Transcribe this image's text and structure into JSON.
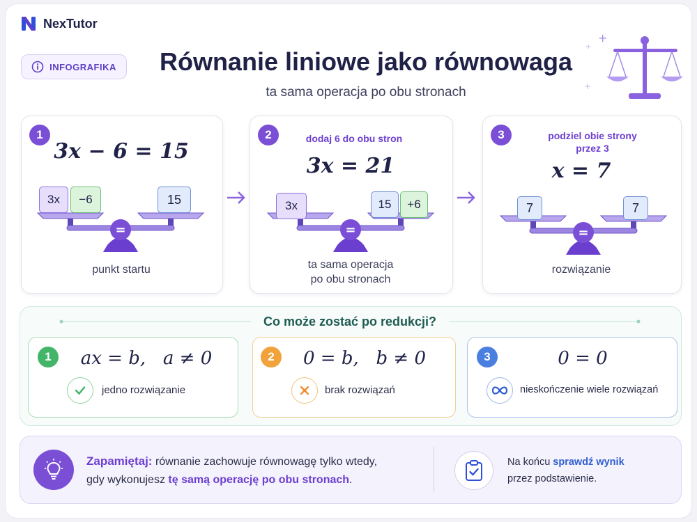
{
  "brand": {
    "name": "NexTutor"
  },
  "badge": {
    "label": "INFOGRAFIKA"
  },
  "header": {
    "title": "Równanie liniowe jako równowaga",
    "subtitle": "ta sama operacja po obu stronach"
  },
  "steps": [
    {
      "number": "1",
      "equation": "3x − 6 = 15",
      "left_tiles": [
        "3x",
        "−6"
      ],
      "right_tiles": [
        "15"
      ],
      "label_lines": [
        "punkt startu"
      ]
    },
    {
      "number": "2",
      "operation_lines": [
        "dodaj 6 do obu stron"
      ],
      "equation": "3x = 21",
      "left_tiles": [
        "3x"
      ],
      "right_tiles": [
        "15",
        "+6"
      ],
      "label_lines": [
        "ta sama operacja",
        "po obu stronach"
      ]
    },
    {
      "number": "3",
      "operation_lines": [
        "podziel obie strony",
        "przez 3"
      ],
      "equation": "x = 7",
      "left_tiles": [
        "7"
      ],
      "right_tiles": [
        "7"
      ],
      "label_lines": [
        "rozwiązanie"
      ]
    }
  ],
  "balance_symbol": "=",
  "reduction": {
    "title": "Co może zostać po redukcji?",
    "options": [
      {
        "number": "1",
        "equation": "ax = b,   a ≠ 0",
        "text": "jedno rozwiązanie",
        "accent": "#43b56a"
      },
      {
        "number": "2",
        "equation": "0 = b,   b ≠ 0",
        "text": "brak rozwiązań",
        "accent": "#f2a23a"
      },
      {
        "number": "3",
        "equation": "0 = 0",
        "text": "nieskończenie wiele rozwiązań",
        "accent": "#4a7fe0"
      }
    ]
  },
  "note": {
    "lead": "Zapamiętaj:",
    "line1": "równanie zachowuje równowagę tylko wtedy,",
    "line2_prefix": "gdy wykonujesz",
    "line2_highlight": "tę samą operację po obu stronach",
    "line2_suffix": ".",
    "check_prefix": "Na końcu",
    "check_highlight": "sprawdź wynik",
    "check_line2": "przez podstawienie."
  },
  "colors": {
    "primary": "#7a4fd6",
    "navy": "#1f2147",
    "green": "#43b56a",
    "orange": "#f2a23a",
    "blue": "#4a7fe0"
  }
}
